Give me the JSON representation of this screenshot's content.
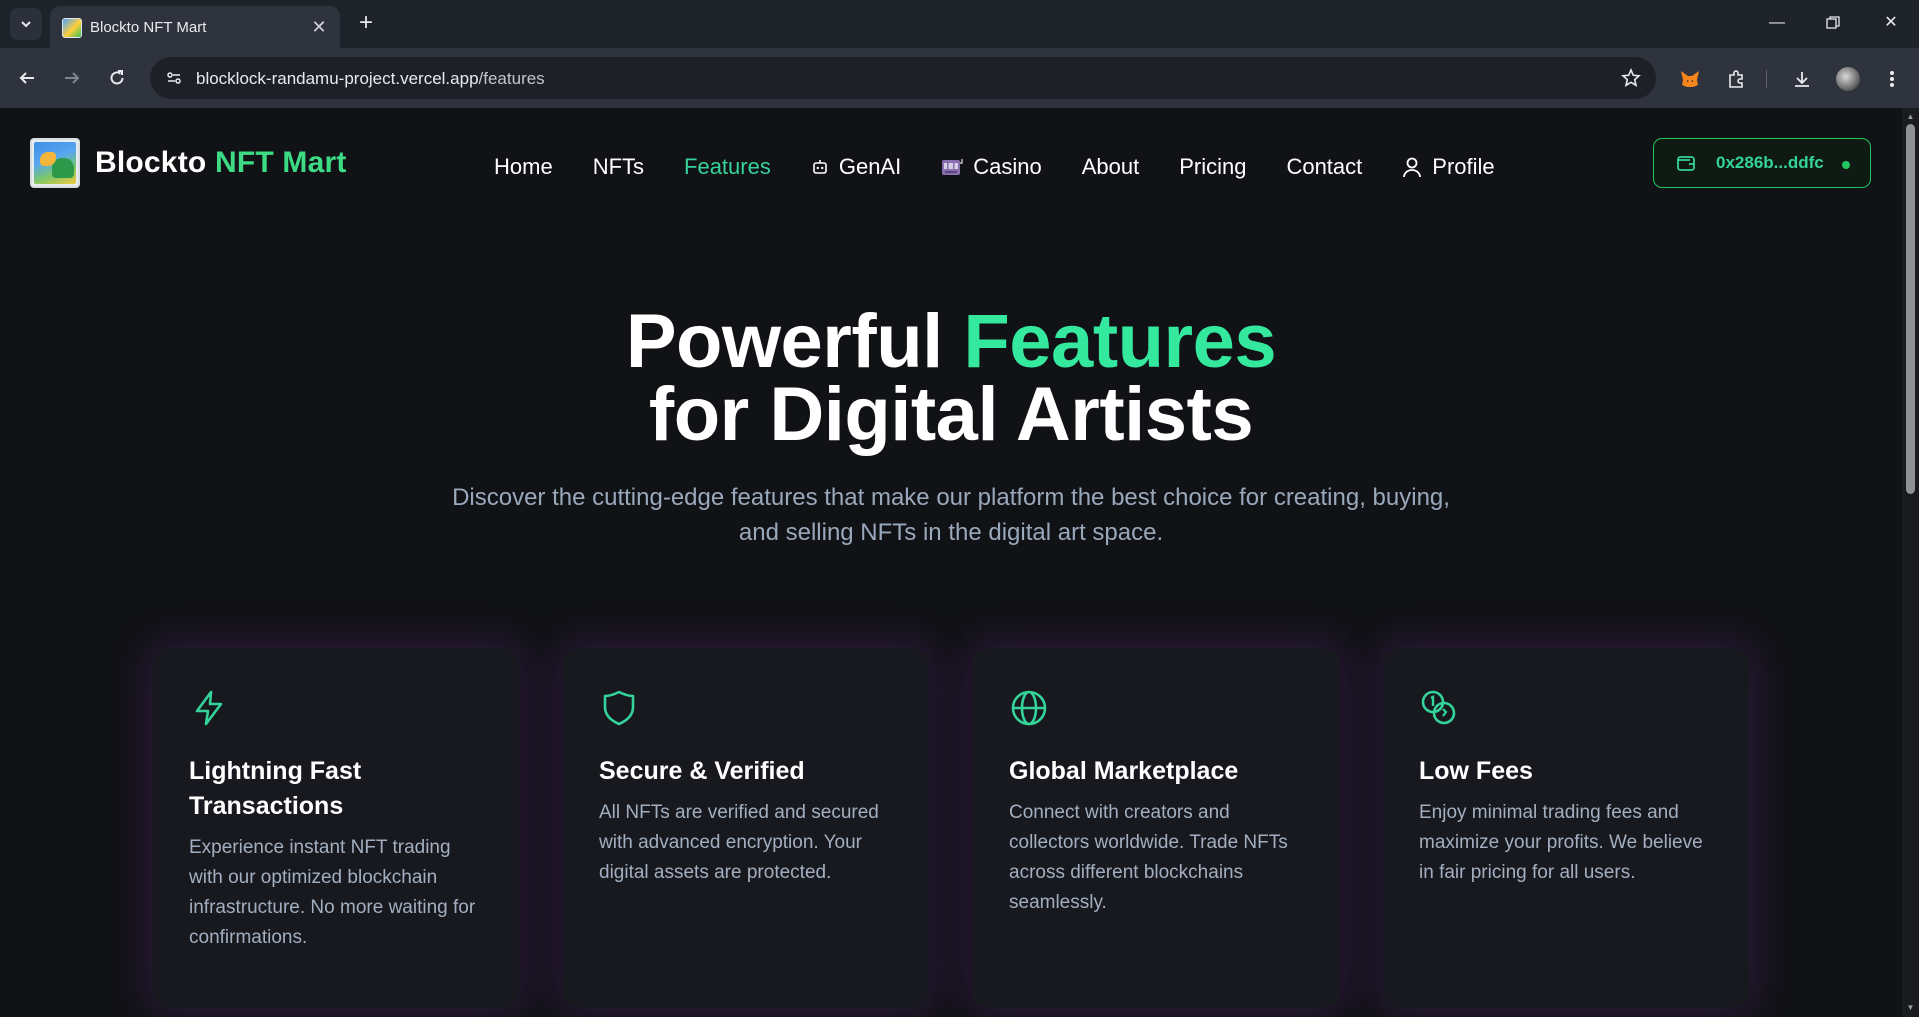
{
  "browser": {
    "tab_title": "Blockto NFT Mart",
    "url_host": "blocklock-randamu-project.vercel.app",
    "url_path": "/features"
  },
  "site": {
    "brand_main": "Blockto",
    "brand_accent": "NFT Mart",
    "nav": [
      {
        "label": "Home",
        "icon": null,
        "active": false
      },
      {
        "label": "NFTs",
        "icon": null,
        "active": false
      },
      {
        "label": "Features",
        "icon": null,
        "active": true
      },
      {
        "label": "GenAI",
        "icon": "robot-icon",
        "active": false
      },
      {
        "label": "Casino",
        "icon": "slot-machine-icon",
        "active": false
      },
      {
        "label": "About",
        "icon": null,
        "active": false
      },
      {
        "label": "Pricing",
        "icon": null,
        "active": false
      },
      {
        "label": "Contact",
        "icon": null,
        "active": false
      },
      {
        "label": "Profile",
        "icon": "user-icon",
        "active": false
      }
    ],
    "wallet_address": "0x286b...ddfc"
  },
  "hero": {
    "title_line1_main": "Powerful",
    "title_line1_accent": "Features",
    "title_line2": "for Digital Artists",
    "subtitle": "Discover the cutting-edge features that make our platform the best choice for creating, buying, and selling NFTs in the digital art space."
  },
  "features": [
    {
      "icon": "lightning-icon",
      "title": "Lightning Fast Transactions",
      "description": "Experience instant NFT trading with our optimized blockchain infrastructure. No more waiting for confirmations."
    },
    {
      "icon": "shield-icon",
      "title": "Secure & Verified",
      "description": "All NFTs are verified and secured with advanced encryption. Your digital assets are protected."
    },
    {
      "icon": "globe-icon",
      "title": "Global Marketplace",
      "description": "Connect with creators and collectors worldwide. Trade NFTs across different blockchains seamlessly."
    },
    {
      "icon": "coins-icon",
      "title": "Low Fees",
      "description": "Enjoy minimal trading fees and maximize your profits. We believe in fair pricing for all users."
    }
  ],
  "colors": {
    "accent": "#34d399",
    "background": "#111216",
    "card": "#17191e",
    "muted_text": "#a3afc0"
  }
}
